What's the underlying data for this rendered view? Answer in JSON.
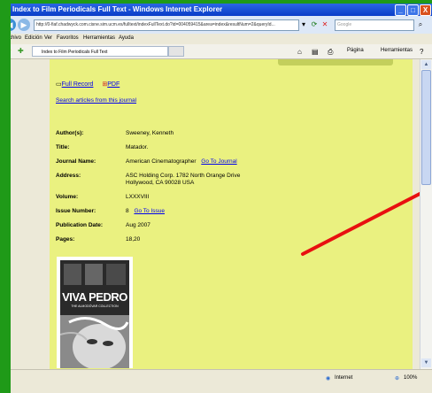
{
  "window": {
    "title": "Index to Film Periodicals Full Text - Windows Internet Explorer",
    "buttons": {
      "minimize": "_",
      "maximize": "□",
      "close": "X"
    }
  },
  "address_bar": {
    "url": "http://0-fiaf.chadwyck.com.cisne.sim.ucm.es/fulltext/indexFullText.do?id=004059415&area=index&resultNum=2&queryId...",
    "search_placeholder": "Google"
  },
  "menu": [
    "Archivo",
    "Edición",
    "Ver",
    "Favoritos",
    "Herramientas",
    "Ayuda"
  ],
  "tab": {
    "label": "Index to Film Periodicals Full Text"
  },
  "toolbar": {
    "page": "Página",
    "tools": "Herramientas"
  },
  "record": {
    "full_record": "Full Record",
    "pdf": "PDF",
    "search_articles": "Search articles from this journal",
    "fields": [
      {
        "label": "Author(s):",
        "value": "Sweeney, Kenneth"
      },
      {
        "label": "Title:",
        "value": "Matador."
      },
      {
        "label": "Journal Name:",
        "value": "American Cinematographer",
        "link": "Go To Journal"
      },
      {
        "label": "Address:",
        "value": "ASC Holding Corp. 1782 North Orange Drive Hollywood, CA 90028 USA"
      },
      {
        "label": "Volume:",
        "value": "LXXXVIII"
      },
      {
        "label": "Issue Number:",
        "value": "8",
        "link": "Go To Issue"
      },
      {
        "label": "Publication Date:",
        "value": "Aug 2007"
      },
      {
        "label": "Pages:",
        "value": "18,20"
      }
    ],
    "cover": {
      "title": "VIVA PEDRO",
      "subtitle": "THE ALMODÓVAR COLLECTION"
    }
  },
  "status_bar": {
    "zone": "Internet",
    "zoom": "100%"
  },
  "colors": {
    "panel": "#eaf180",
    "slide_bg": "#1f9a18",
    "arrow": "#e81010"
  }
}
